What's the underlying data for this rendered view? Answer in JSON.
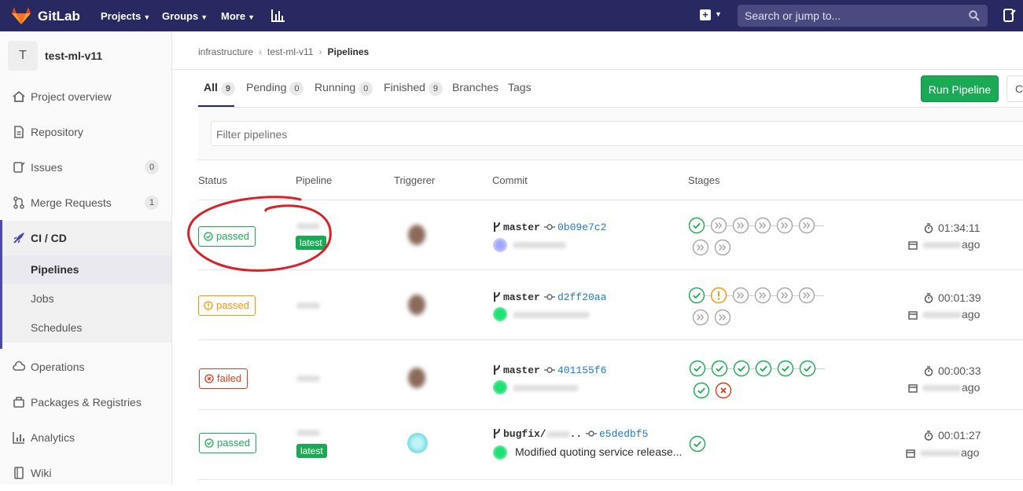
{
  "topnav": {
    "brand": "GitLab",
    "projects": "Projects",
    "groups": "Groups",
    "more": "More",
    "search_placeholder": "Search or jump to..."
  },
  "sidebar": {
    "project_initial": "T",
    "project_name": "test-ml-v11",
    "items": [
      {
        "label": "Project overview"
      },
      {
        "label": "Repository"
      },
      {
        "label": "Issues",
        "count": "0"
      },
      {
        "label": "Merge Requests",
        "count": "1"
      },
      {
        "label": "CI / CD"
      },
      {
        "label": "Operations"
      },
      {
        "label": "Packages & Registries"
      },
      {
        "label": "Analytics"
      },
      {
        "label": "Wiki"
      }
    ],
    "cicd_sub": [
      {
        "label": "Pipelines"
      },
      {
        "label": "Jobs"
      },
      {
        "label": "Schedules"
      }
    ]
  },
  "breadcrumb": {
    "group": "infrastructure",
    "project": "test-ml-v11",
    "current": "Pipelines"
  },
  "tabs": [
    {
      "label": "All",
      "count": "9"
    },
    {
      "label": "Pending",
      "count": "0"
    },
    {
      "label": "Running",
      "count": "0"
    },
    {
      "label": "Finished",
      "count": "9"
    },
    {
      "label": "Branches"
    },
    {
      "label": "Tags"
    }
  ],
  "actions": {
    "run_pipeline": "Run Pipeline",
    "clear_caches": "Cl"
  },
  "filter": {
    "placeholder": "Filter pipelines"
  },
  "table": {
    "headers": [
      "Status",
      "Pipeline",
      "Triggerer",
      "Commit",
      "Stages"
    ],
    "rows": [
      {
        "status": "passed",
        "status_kind": "success",
        "latest": "latest",
        "ref": "master",
        "sha": "0b09e7c2",
        "commit_title": "",
        "duration": "01:34:11",
        "finished": "ago"
      },
      {
        "status": "passed",
        "status_kind": "warning",
        "latest": "",
        "ref": "master",
        "sha": "d2ff20aa",
        "commit_title": "",
        "duration": "00:01:39",
        "finished": "ago"
      },
      {
        "status": "failed",
        "status_kind": "failed",
        "latest": "",
        "ref": "master",
        "sha": "401155f6",
        "commit_title": "",
        "duration": "00:00:33",
        "finished": "ago"
      },
      {
        "status": "passed",
        "status_kind": "success",
        "latest": "latest",
        "ref": "bugfix/",
        "sha": "e5dedbf5",
        "commit_title": "Modified quoting service release...",
        "duration": "00:01:27",
        "finished": "ago"
      }
    ]
  },
  "colors": {
    "nav": "#292961",
    "success": "#1aaa55",
    "warning": "#fc9403",
    "failed": "#db3b21",
    "skipped": "#a7a7a7",
    "annotation": "#d6222a"
  }
}
